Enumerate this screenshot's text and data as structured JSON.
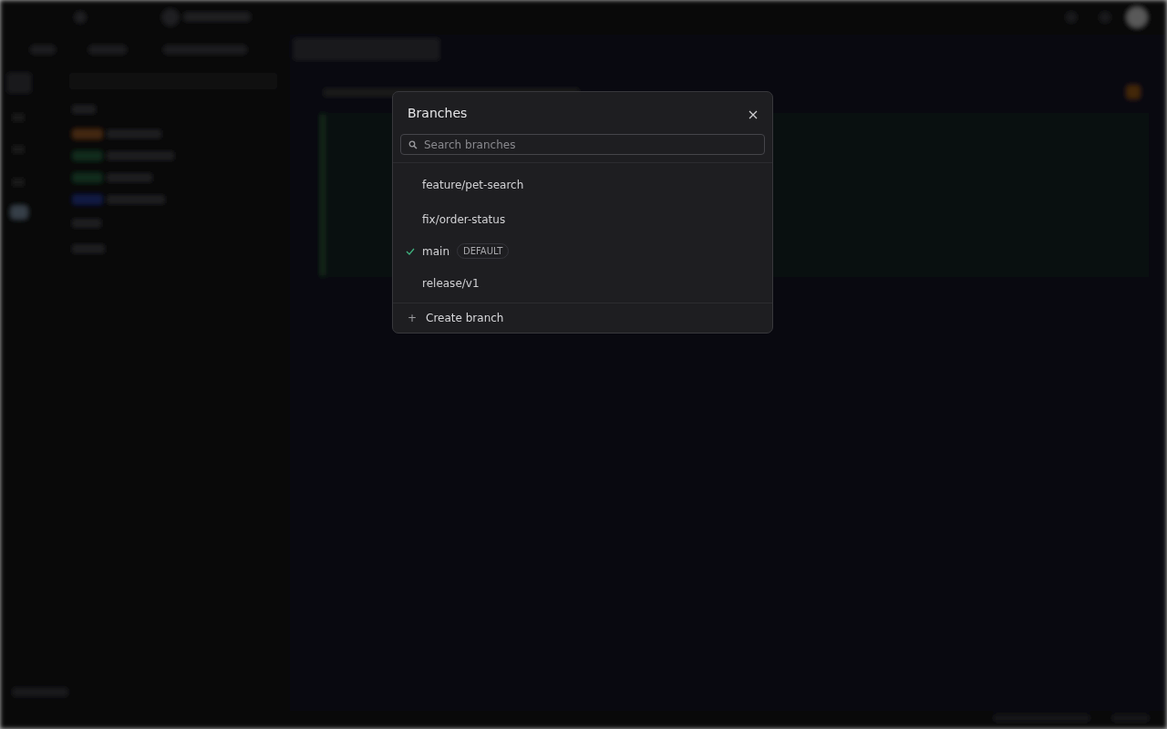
{
  "dialog": {
    "title": "Branches",
    "search": {
      "placeholder": "Search branches"
    },
    "branches": [
      {
        "name": "feature/pet-search",
        "selected": false
      },
      {
        "name": "fix/order-status",
        "selected": false
      },
      {
        "name": "main",
        "selected": true,
        "badge": "DEFAULT"
      },
      {
        "name": "release/v1",
        "selected": false
      }
    ],
    "create_action": {
      "icon": "+",
      "label": "Create branch"
    }
  }
}
